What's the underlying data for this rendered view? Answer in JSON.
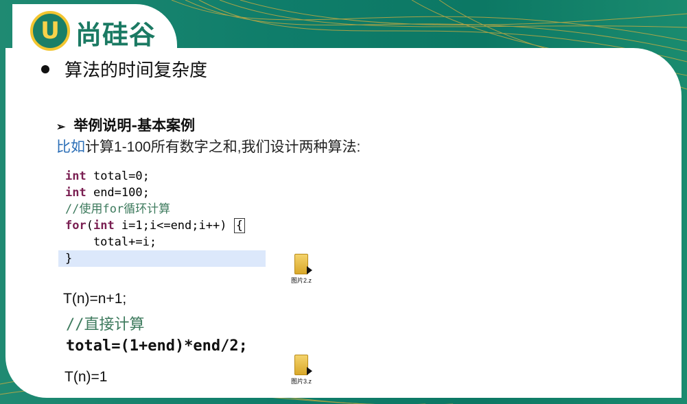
{
  "logo": {
    "badge": "U",
    "text": "尚硅谷"
  },
  "heading": "算法的时间复杂度",
  "subheading": "举例说明-基本案例",
  "intro": {
    "highlight": "比如",
    "rest": "计算1-100所有数字之和,我们设计两种算法:"
  },
  "code1": {
    "line1_kw": "int",
    "line1_rest": " total=0;",
    "line2_kw": "int",
    "line2_rest": " end=100;",
    "line3_comment": "//使用for循环计算",
    "line4_kw1": "for",
    "line4_mid": "(",
    "line4_kw2": "int",
    "line4_rest": " i=1;i<=end;i++) ",
    "line4_brace": "{",
    "line5": "    total+=i;",
    "line6": "}"
  },
  "complexity1": "T(n)=n+1;",
  "code2": {
    "comment": "//直接计算",
    "statement": "total=(1+end)*end/2;"
  },
  "complexity2": "T(n)=1",
  "files": [
    {
      "label": "图片2.z"
    },
    {
      "label": "图片3.z"
    }
  ],
  "colors": {
    "background": "#0f7d6a",
    "brand": "#1b7a63",
    "accent": "#f2c530"
  }
}
